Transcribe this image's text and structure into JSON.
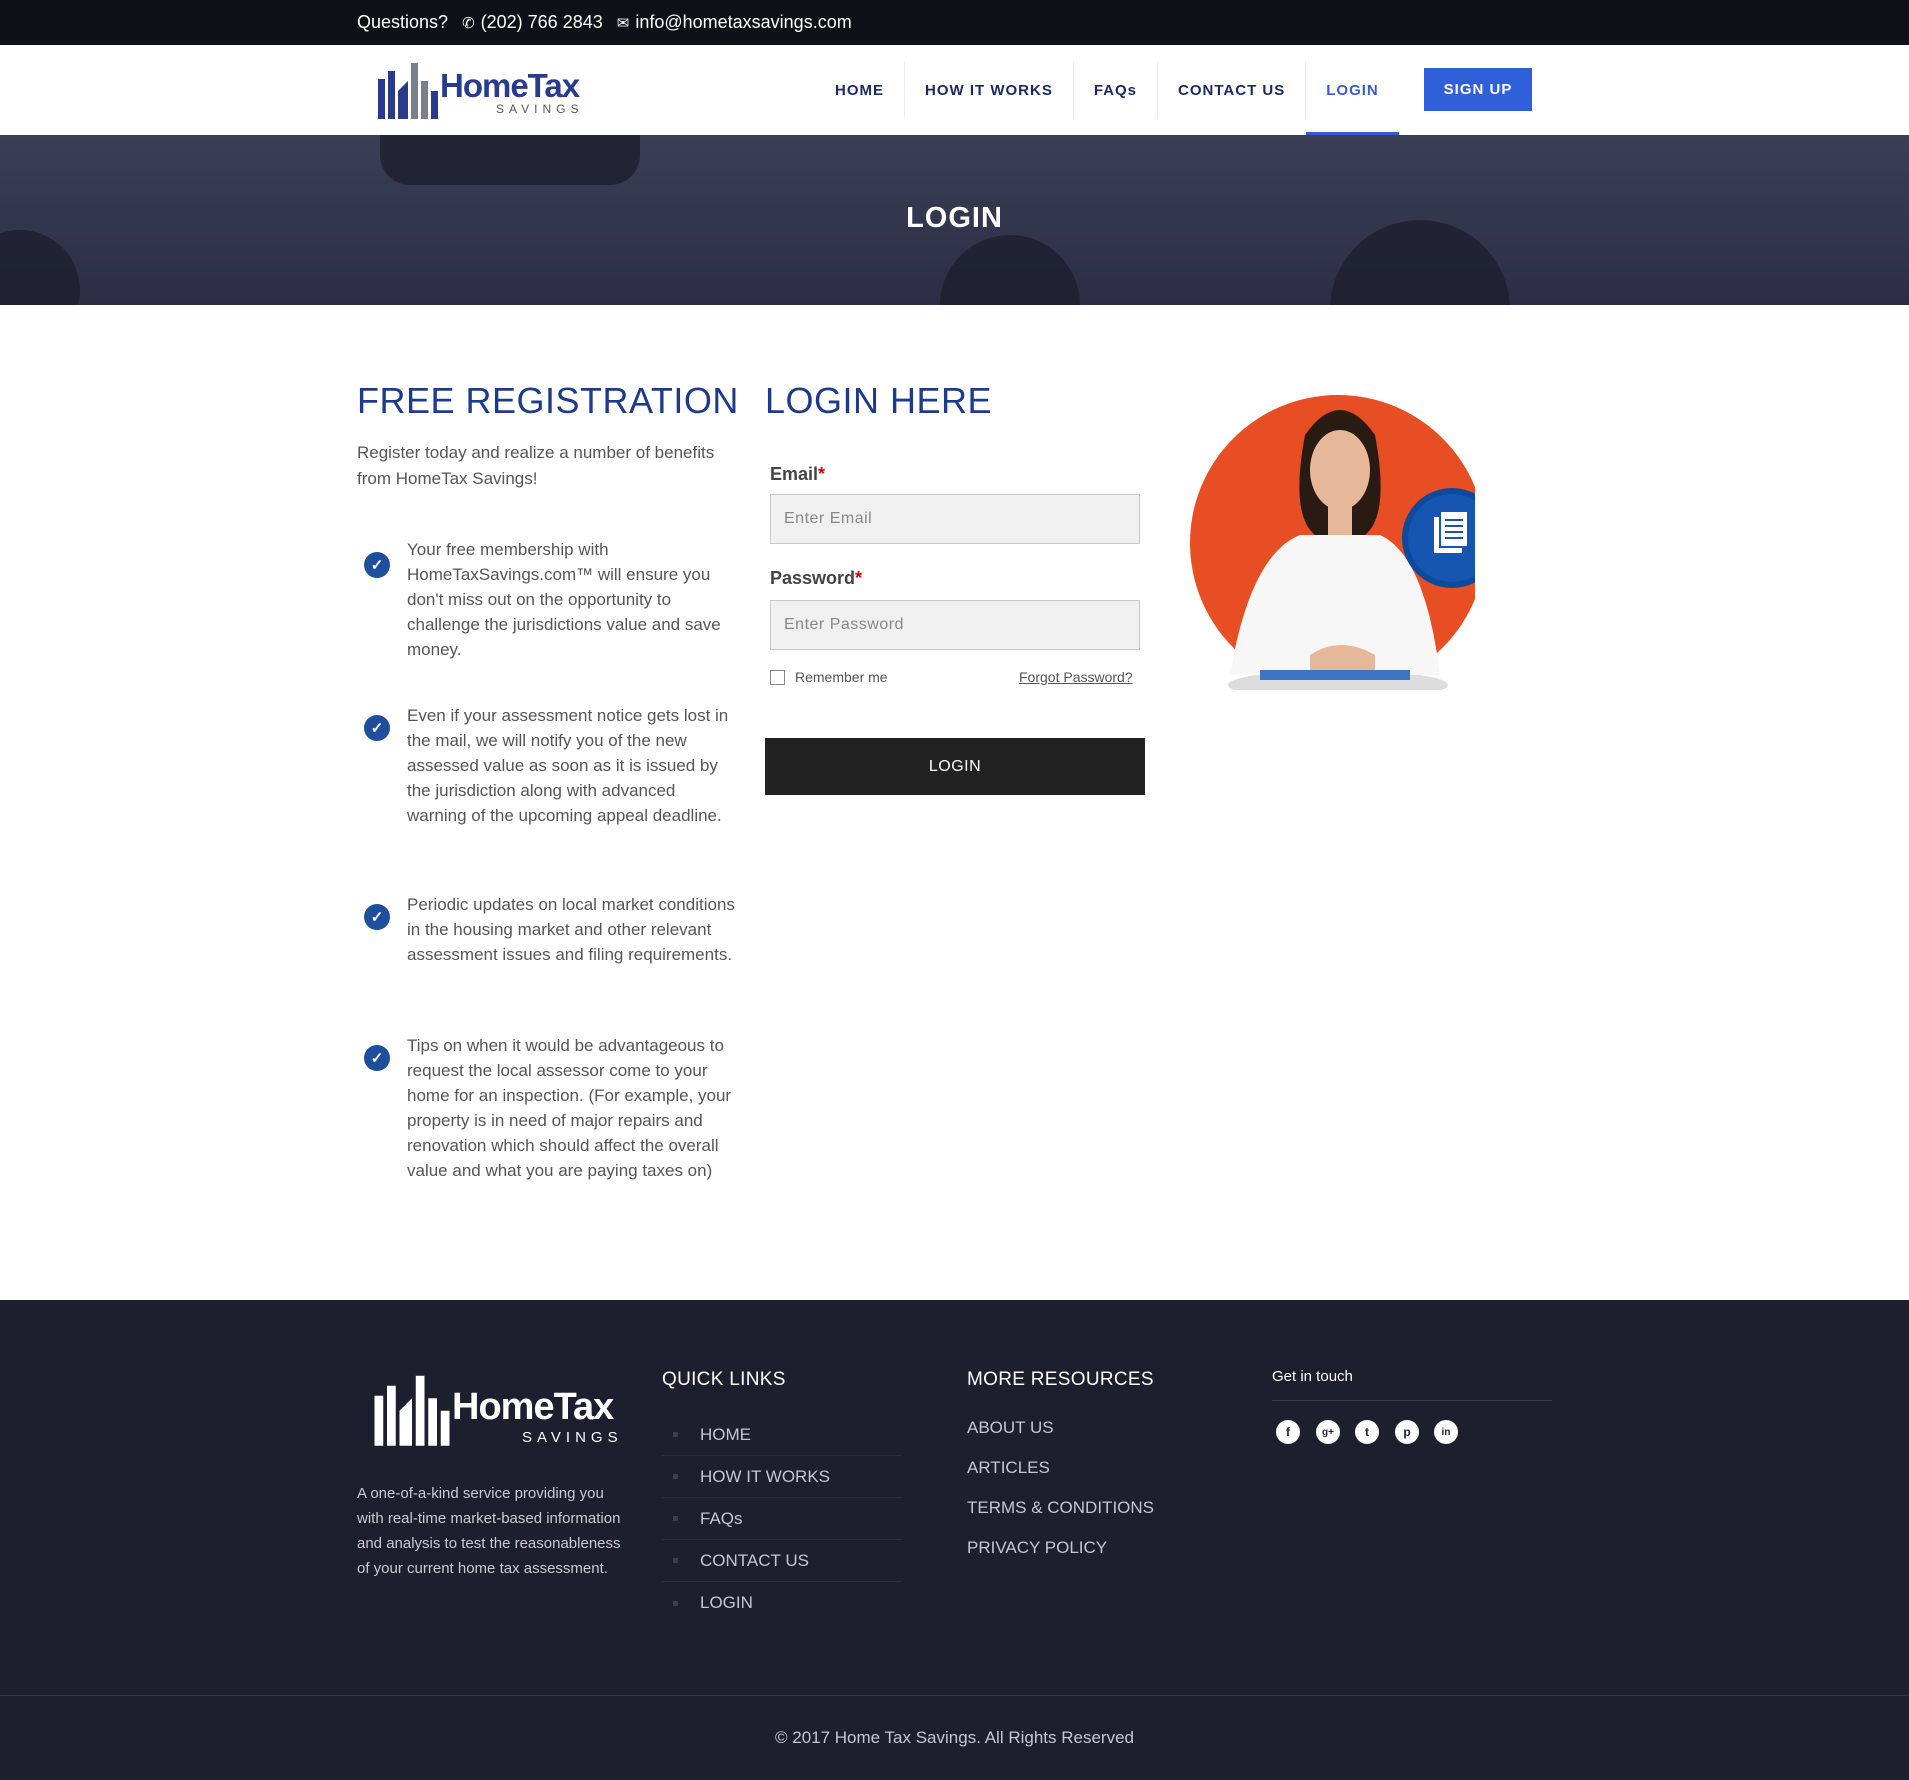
{
  "topbar": {
    "questions": "Questions?",
    "phone": "(202) 766 2843",
    "email": "info@hometaxsavings.com",
    "phone_icon": "phone-icon",
    "email_icon": "mail-icon"
  },
  "brand": {
    "name": "HomeTax",
    "sub": "SAVINGS",
    "primary_color": "#1e3a8a",
    "accent_color": "#2f5fd9"
  },
  "nav": {
    "items": [
      "HOME",
      "HOW IT WORKS",
      "FAQs",
      "CONTACT US",
      "LOGIN"
    ],
    "active": "LOGIN",
    "signup": "SIGN UP"
  },
  "banner": {
    "title": "LOGIN"
  },
  "registration": {
    "title": "FREE REGISTRATION",
    "intro": "Register today and realize a number of benefits from HomeTax Savings!",
    "benefits": [
      "Your free membership with HomeTaxSavings.com™ will ensure you don't miss out on the opportunity to challenge the jurisdictions value and save money.",
      "Even if your assessment notice gets lost in the mail, we will notify you of the new assessed value as soon as it is issued by the jurisdiction along with advanced warning of the upcoming appeal deadline.",
      "Periodic updates on local market conditions in the housing market and other relevant assessment issues and filing requirements.",
      "Tips on when it would be advantageous to request the local assessor come to your home for an inspection. (For example, your property is in need of major repairs and renovation which should affect the overall value and what you are paying taxes on)"
    ]
  },
  "login": {
    "title": "LOGIN HERE",
    "email_label": "Email",
    "email_placeholder": "Enter Email",
    "password_label": "Password",
    "password_placeholder": "Enter Password",
    "required_mark": "*",
    "remember": "Remember me",
    "forgot": "Forgot Password?",
    "button": "LOGIN"
  },
  "footer": {
    "brand_name": "HomeTax",
    "brand_sub": "SAVINGS",
    "description": "A one-of-a-kind service providing you with real-time market-based information and analysis to test the reasonableness of your current home tax assessment.",
    "quick_links_title": "QUICK LINKS",
    "quick_links": [
      "HOME",
      "HOW IT WORKS",
      "FAQs",
      "CONTACT US",
      "LOGIN"
    ],
    "resources_title": "MORE RESOURCES",
    "resources": [
      "ABOUT US",
      "ARTICLES",
      "TERMS & CONDITIONS",
      "PRIVACY POLICY"
    ],
    "get_in_touch": "Get in touch",
    "social": [
      "facebook-icon",
      "google-plus-icon",
      "twitter-icon",
      "pinterest-icon",
      "linkedin-icon"
    ],
    "copyright": "© 2017 Home Tax Savings. All Rights Reserved"
  }
}
